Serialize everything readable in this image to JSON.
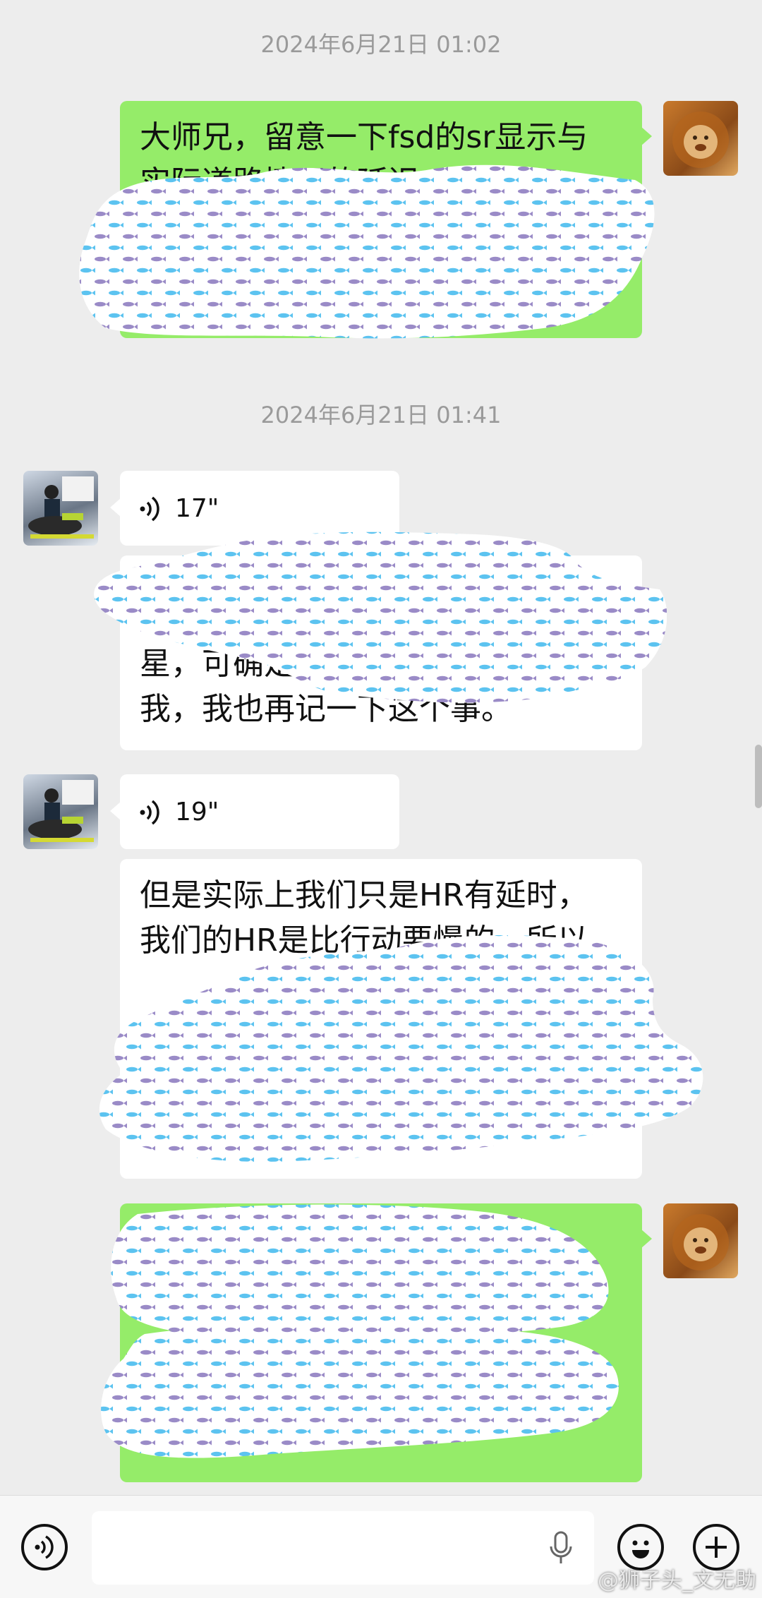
{
  "timestamps": [
    "2024年6月21日 01:02",
    "2024年6月21日 01:41"
  ],
  "messages": {
    "m1_line1": "大师兄，留意一下fsd的sr显示与",
    "m1_line2": "实际道路情况的延迟",
    "v1_duration": "17\"",
    "m2_partial": "星，可确定",
    "m2_last": "我，我也再记一下这个事。",
    "v2_duration": "19\"",
    "m3_line1": "但是实际上我们只是HR有延时，",
    "m3_line2": "我们的HR是比行动要慢的，所以"
  },
  "input_bar": {
    "voice_icon": "voice-icon",
    "emoji_icon": "emoji-icon",
    "plus_icon": "plus-icon",
    "mic_icon": "mic-icon"
  },
  "watermark": "@狮子头_文无助",
  "colors": {
    "background": "#ededed",
    "sent_bubble": "#95ec69",
    "received_bubble": "#ffffff",
    "censor_blue": "#5cc3f0",
    "censor_purple": "#9a8bc7"
  }
}
